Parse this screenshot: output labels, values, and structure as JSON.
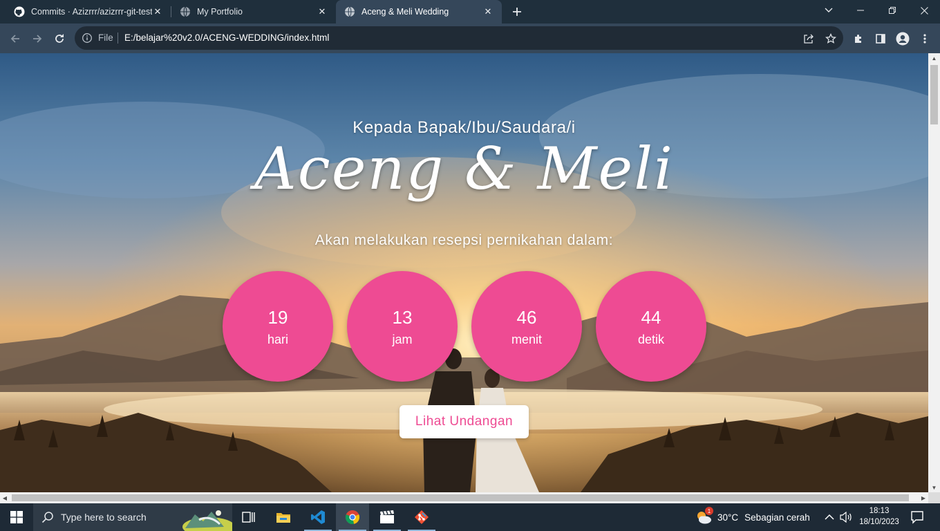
{
  "browser": {
    "tabs": [
      {
        "title": "Commits · Azizrrr/azizrrr-git-test",
        "icon": "github-icon",
        "active": false
      },
      {
        "title": "My Portfolio",
        "icon": "globe-icon",
        "active": false
      },
      {
        "title": "Aceng & Meli Wedding",
        "icon": "globe-icon",
        "active": true
      }
    ],
    "address": {
      "scheme_label": "File",
      "url": "E:/belajar%20v2.0/ACENG-WEDDING/index.html"
    }
  },
  "page": {
    "greeting": "Kepada Bapak/Ibu/Saudara/i",
    "couple": "Aceng & Meli",
    "subtitle": "Akan melakukan resepsi pernikahan dalam:",
    "countdown": [
      {
        "value": "19",
        "unit": "hari"
      },
      {
        "value": "13",
        "unit": "jam"
      },
      {
        "value": "46",
        "unit": "menit"
      },
      {
        "value": "44",
        "unit": "detik"
      }
    ],
    "cta_label": "Lihat Undangan",
    "colors": {
      "accent": "#ee4b93",
      "button_bg": "#ffffff"
    }
  },
  "taskbar": {
    "search_placeholder": "Type here to search",
    "apps": [
      "task-view-icon",
      "file-explorer-icon",
      "vscode-icon",
      "chrome-icon",
      "clapper-icon",
      "git-icon"
    ],
    "weather": {
      "temp": "30°C",
      "condition": "Sebagian cerah",
      "badge": "1"
    },
    "clock": {
      "time": "18:13",
      "date": "18/10/2023"
    }
  }
}
